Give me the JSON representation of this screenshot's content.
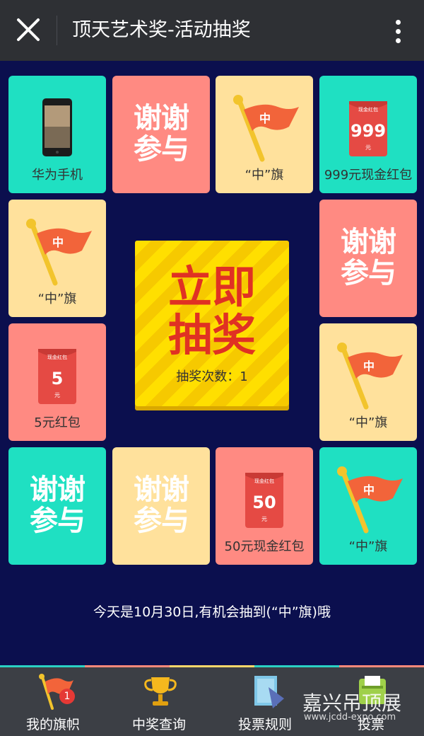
{
  "header": {
    "title": "顶天艺术奖-活动抽奖"
  },
  "tiles": {
    "t1": {
      "caption": "华为手机"
    },
    "t2": {
      "line1": "谢谢",
      "line2": "参与"
    },
    "t3": {
      "caption": "“中”旗"
    },
    "t4": {
      "caption": "999元现金红包",
      "amount": "999"
    },
    "t5": {
      "caption": "“中”旗"
    },
    "t6": {
      "line1": "谢谢",
      "line2": "参与"
    },
    "t7": {
      "caption": "5元红包",
      "amount": "5"
    },
    "t8": {
      "caption": "“中”旗"
    },
    "t9": {
      "line1": "谢谢",
      "line2": "参与"
    },
    "t10": {
      "line1": "谢谢",
      "line2": "参与"
    },
    "t11": {
      "caption": "50元现金红包",
      "amount": "50"
    },
    "t12": {
      "caption": "“中”旗"
    }
  },
  "flag_char": "中",
  "envelope_top": "现金红包",
  "envelope_unit": "元",
  "center": {
    "line1": "立即",
    "line2": "抽奖",
    "count_label": "抽奖次数：1"
  },
  "hint": "今天是10月30日,有机会抽到(“中”旗)哦",
  "nav": [
    {
      "label": "我的旗帜",
      "badge": "1"
    },
    {
      "label": "中奖查询"
    },
    {
      "label": "投票规则"
    },
    {
      "label": "投票"
    }
  ],
  "watermark": {
    "text": "嘉兴吊顶展",
    "url": "www.jcdd-expo.com"
  },
  "colors": {
    "teal": "#1fe0c2",
    "salmon": "#ff8a82",
    "cream": "#ffe19c",
    "bg": "#0b0f4e",
    "accent": "#e03123"
  }
}
